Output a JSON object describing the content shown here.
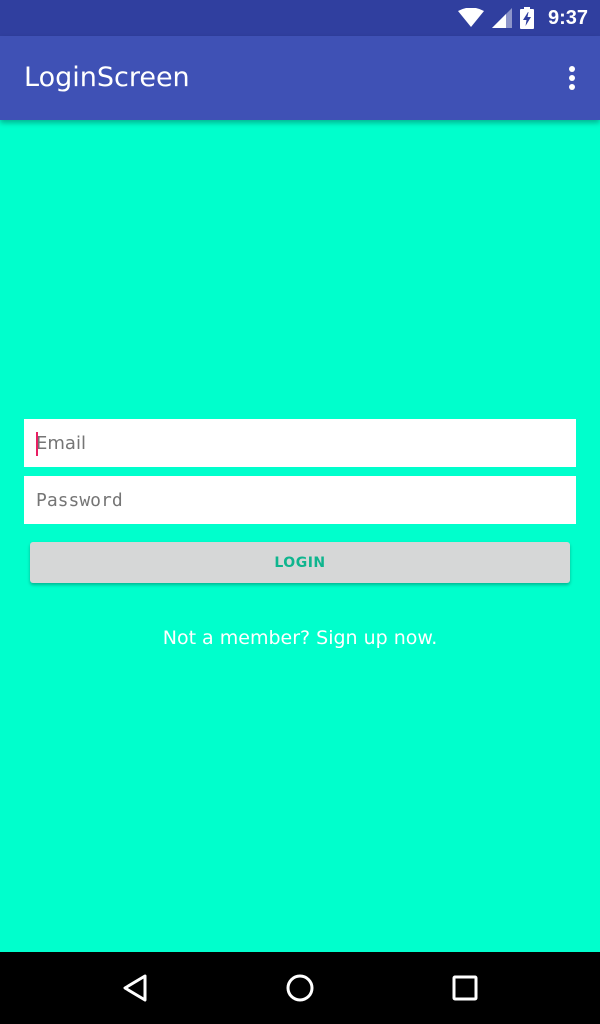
{
  "status_bar": {
    "time": "9:37",
    "icons": [
      "wifi-icon",
      "cellular-signal-icon",
      "battery-charging-icon"
    ]
  },
  "app_bar": {
    "title": "LoginScreen",
    "menu_icon": "overflow-menu-icon"
  },
  "form": {
    "email": {
      "value": "",
      "placeholder": "Email"
    },
    "password": {
      "value": "",
      "placeholder": "Password"
    },
    "login_label": "LOGIN",
    "signup_text": "Not a member? Sign up now."
  },
  "nav_bar": {
    "icons": [
      "back-icon",
      "home-icon",
      "recent-apps-icon"
    ]
  },
  "colors": {
    "background": "#00ffcc",
    "app_bar": "#3f51b5",
    "status_bar": "#303f9f",
    "button": "#d6d7d7",
    "button_text": "#0fb58e",
    "cursor": "#e91e63"
  }
}
